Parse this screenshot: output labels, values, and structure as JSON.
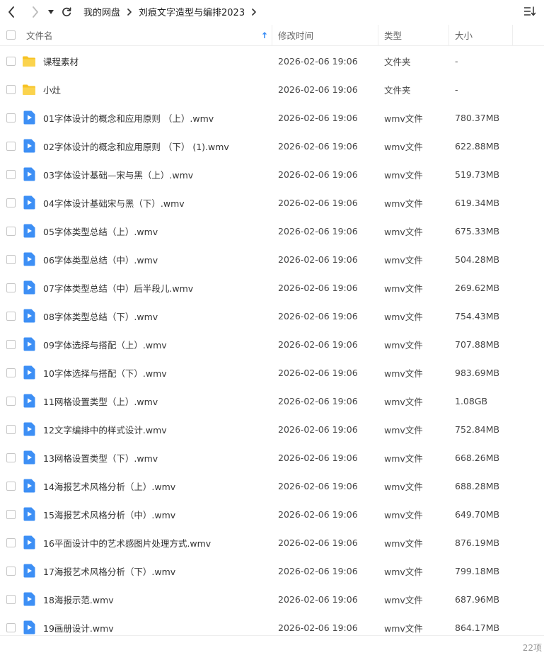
{
  "breadcrumb": [
    "我的网盘",
    "刘痕文字造型与编排2023"
  ],
  "header": {
    "name": "文件名",
    "modified": "修改时间",
    "type": "类型",
    "size": "大小"
  },
  "files": [
    {
      "name": "课程素材",
      "modified": "2026-02-06 19:06",
      "type": "文件夹",
      "size": "-",
      "icon": "folder-icon"
    },
    {
      "name": "小灶",
      "modified": "2026-02-06 19:06",
      "type": "文件夹",
      "size": "-",
      "icon": "folder-icon"
    },
    {
      "name": "01字体设计的概念和应用原则 （上）.wmv",
      "modified": "2026-02-06 19:06",
      "type": "wmv文件",
      "size": "780.37MB",
      "icon": "video-file-icon"
    },
    {
      "name": "02字体设计的概念和应用原则 （下） (1).wmv",
      "modified": "2026-02-06 19:06",
      "type": "wmv文件",
      "size": "622.88MB",
      "icon": "video-file-icon"
    },
    {
      "name": "03字体设计基础—宋与黑（上）.wmv",
      "modified": "2026-02-06 19:06",
      "type": "wmv文件",
      "size": "519.73MB",
      "icon": "video-file-icon"
    },
    {
      "name": "04字体设计基础宋与黑（下）.wmv",
      "modified": "2026-02-06 19:06",
      "type": "wmv文件",
      "size": "619.34MB",
      "icon": "video-file-icon"
    },
    {
      "name": "05字体类型总结（上）.wmv",
      "modified": "2026-02-06 19:06",
      "type": "wmv文件",
      "size": "675.33MB",
      "icon": "video-file-icon"
    },
    {
      "name": "06字体类型总结（中）.wmv",
      "modified": "2026-02-06 19:06",
      "type": "wmv文件",
      "size": "504.28MB",
      "icon": "video-file-icon"
    },
    {
      "name": "07字体类型总结（中）后半段儿.wmv",
      "modified": "2026-02-06 19:06",
      "type": "wmv文件",
      "size": "269.62MB",
      "icon": "video-file-icon"
    },
    {
      "name": "08字体类型总结（下）.wmv",
      "modified": "2026-02-06 19:06",
      "type": "wmv文件",
      "size": "754.43MB",
      "icon": "video-file-icon"
    },
    {
      "name": "09字体选择与搭配（上）.wmv",
      "modified": "2026-02-06 19:06",
      "type": "wmv文件",
      "size": "707.88MB",
      "icon": "video-file-icon"
    },
    {
      "name": "10字体选择与搭配（下）.wmv",
      "modified": "2026-02-06 19:06",
      "type": "wmv文件",
      "size": "983.69MB",
      "icon": "video-file-icon"
    },
    {
      "name": "11网格设置类型（上）.wmv",
      "modified": "2026-02-06 19:06",
      "type": "wmv文件",
      "size": "1.08GB",
      "icon": "video-file-icon"
    },
    {
      "name": "12文字编排中的样式设计.wmv",
      "modified": "2026-02-06 19:06",
      "type": "wmv文件",
      "size": "752.84MB",
      "icon": "video-file-icon"
    },
    {
      "name": "13网格设置类型（下）.wmv",
      "modified": "2026-02-06 19:06",
      "type": "wmv文件",
      "size": "668.26MB",
      "icon": "video-file-icon"
    },
    {
      "name": "14海报艺术风格分析（上）.wmv",
      "modified": "2026-02-06 19:06",
      "type": "wmv文件",
      "size": "688.28MB",
      "icon": "video-file-icon"
    },
    {
      "name": "15海报艺术风格分析（中）.wmv",
      "modified": "2026-02-06 19:06",
      "type": "wmv文件",
      "size": "649.70MB",
      "icon": "video-file-icon"
    },
    {
      "name": "16平面设计中的艺术感图片处理方式.wmv",
      "modified": "2026-02-06 19:06",
      "type": "wmv文件",
      "size": "876.19MB",
      "icon": "video-file-icon"
    },
    {
      "name": "17海报艺术风格分析（下）.wmv",
      "modified": "2026-02-06 19:06",
      "type": "wmv文件",
      "size": "799.18MB",
      "icon": "video-file-icon"
    },
    {
      "name": "18海报示范.wmv",
      "modified": "2026-02-06 19:06",
      "type": "wmv文件",
      "size": "687.96MB",
      "icon": "video-file-icon"
    },
    {
      "name": "19画册设计.wmv",
      "modified": "2026-02-06 19:06",
      "type": "wmv文件",
      "size": "864.17MB",
      "icon": "video-file-icon"
    }
  ],
  "footer": {
    "count": "22项"
  },
  "colors": {
    "folder": "#f7c325",
    "video": "#3d8ff5",
    "muted": "#999999"
  }
}
